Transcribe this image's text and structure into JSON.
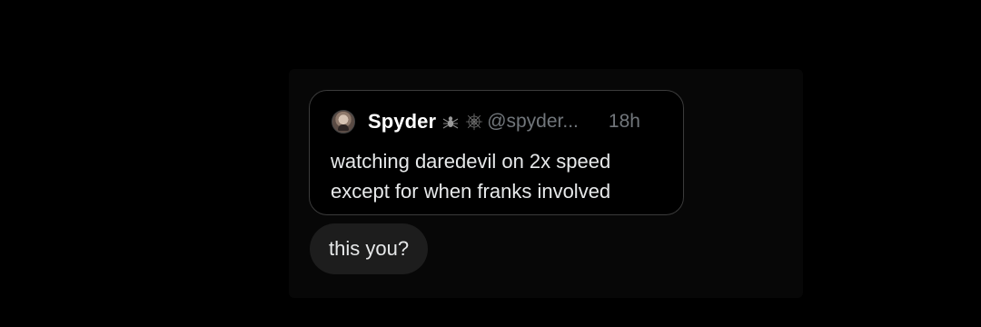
{
  "quote": {
    "author_name": "Spyder",
    "badges": [
      "spider-icon",
      "spider-web-icon"
    ],
    "handle": "@spyder...",
    "time": "18h",
    "text_line1": "watching daredevil on 2x speed",
    "text_line2": "except for when franks involved"
  },
  "reply": {
    "text": "this you?"
  },
  "colors": {
    "background": "#000000",
    "text_primary": "#e7e9ea",
    "text_secondary": "#71767b",
    "card_border": "#3b3b3b",
    "bubble": "#1d1d1d"
  }
}
